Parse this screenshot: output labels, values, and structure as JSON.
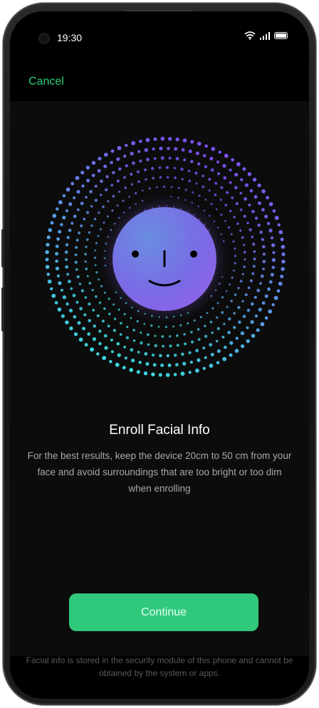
{
  "status_bar": {
    "time": "19:30",
    "icons": [
      "wifi-icon",
      "signal-icon",
      "battery-icon"
    ]
  },
  "nav": {
    "cancel_label": "Cancel"
  },
  "hero": {
    "illustration": "face-scan-dots",
    "face_icon": "smiley-face-icon",
    "colors": {
      "dots_primary": "#8a3cff",
      "dots_secondary": "#3fe0e8",
      "face": "#7a6ae6"
    }
  },
  "content": {
    "title": "Enroll Facial Info",
    "description": "For the best results, keep the device 20cm to 50 cm from your face and avoid surroundings that are too bright or too dim when enrolling"
  },
  "actions": {
    "continue_label": "Continue",
    "accent_color": "#30c97c"
  },
  "footer": {
    "note": "Facial info is stored in the security module of this phone and cannot be obtained by the system or apps."
  }
}
